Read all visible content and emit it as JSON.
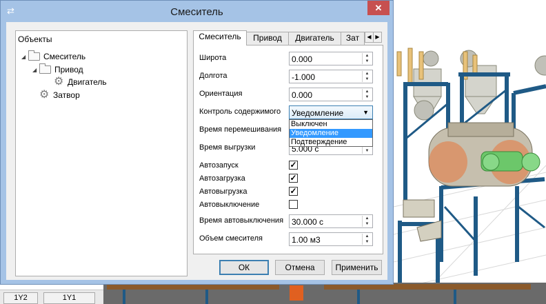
{
  "dialog": {
    "title": "Смеситель",
    "close_symbol": "✕",
    "window_icon": "app-icon"
  },
  "tree": {
    "header": "Объекты",
    "items": [
      {
        "label": "Смеситель",
        "icon": "folder-icon",
        "expanded": true
      },
      {
        "label": "Привод",
        "icon": "folder-icon",
        "expanded": true
      },
      {
        "label": "Двигатель",
        "icon": "gear-icon"
      },
      {
        "label": "Затвор",
        "icon": "gear-icon"
      }
    ]
  },
  "tabs": [
    {
      "label": "Смеситель",
      "active": true
    },
    {
      "label": "Привод"
    },
    {
      "label": "Двигатель"
    },
    {
      "label": "Зат"
    }
  ],
  "props": {
    "latitude": {
      "label": "Широта",
      "value": "0.000"
    },
    "longitude": {
      "label": "Долгота",
      "value": "-1.000"
    },
    "orientation": {
      "label": "Ориентация",
      "value": "0.000"
    },
    "content_control": {
      "label": "Контроль содержимого",
      "value": "Уведомление"
    },
    "mix_time": {
      "label": "Время перемешивания"
    },
    "unload_time": {
      "label": "Время выгрузки",
      "value": "5.000 с"
    },
    "autostart": {
      "label": "Автозапуск",
      "checked": true
    },
    "autoload": {
      "label": "Автозагрузка",
      "checked": true
    },
    "autounload": {
      "label": "Автовыгрузка",
      "checked": true
    },
    "autooff": {
      "label": "Автовыключение",
      "checked": false
    },
    "autooff_time": {
      "label": "Время автовыключения",
      "value": "30.000 с"
    },
    "mixer_volume": {
      "label": "Объем смесителя",
      "value": "1.00 м3"
    }
  },
  "dropdown_options": [
    "Выключен",
    "Уведомление",
    "Подтверждение"
  ],
  "dropdown_selected": "Уведомление",
  "buttons": {
    "ok": "ОК",
    "cancel": "Отмена",
    "apply": "Применить"
  },
  "bottom_tabs": [
    "1Y2",
    "1Y1"
  ],
  "colors": {
    "titlebar": "#a5c3e6",
    "close": "#c75050",
    "selection": "#3399ff",
    "steel": "#1f5a86"
  }
}
